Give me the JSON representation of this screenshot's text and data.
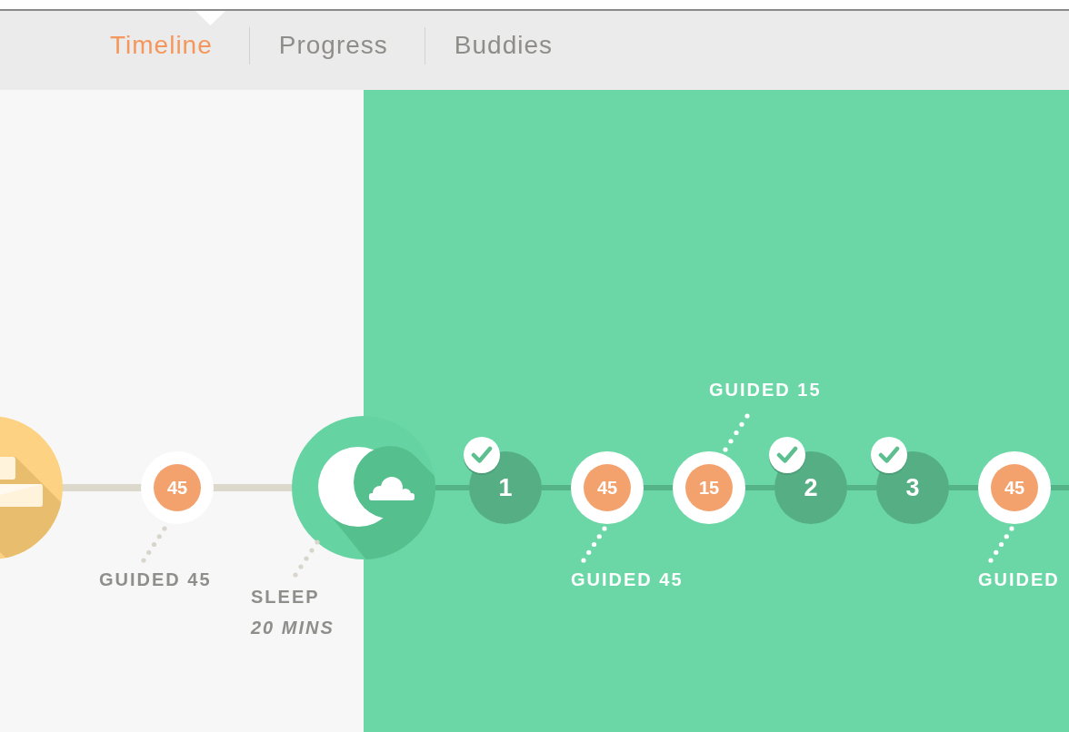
{
  "nav": {
    "tabs": [
      {
        "label": "Timeline",
        "selected": true
      },
      {
        "label": "Progress",
        "selected": false
      },
      {
        "label": "Buddies",
        "selected": false
      }
    ]
  },
  "timeline": {
    "sections": [
      {
        "kind": "past",
        "nodes": [
          {
            "kind": "rest"
          },
          {
            "kind": "session",
            "value": "45",
            "label": "GUIDED 45"
          },
          {
            "kind": "sleep",
            "label": "SLEEP",
            "detail": "20 MINS"
          }
        ]
      },
      {
        "kind": "current",
        "nodes": [
          {
            "kind": "day",
            "value": "1",
            "checked": true
          },
          {
            "kind": "session",
            "value": "45",
            "label": "GUIDED 45"
          },
          {
            "kind": "session",
            "value": "15",
            "top_label": "GUIDED 15"
          },
          {
            "kind": "day",
            "value": "2",
            "checked": true
          },
          {
            "kind": "day",
            "value": "3",
            "checked": true
          },
          {
            "kind": "session",
            "value": "45",
            "label": "GUIDED"
          }
        ]
      }
    ]
  }
}
